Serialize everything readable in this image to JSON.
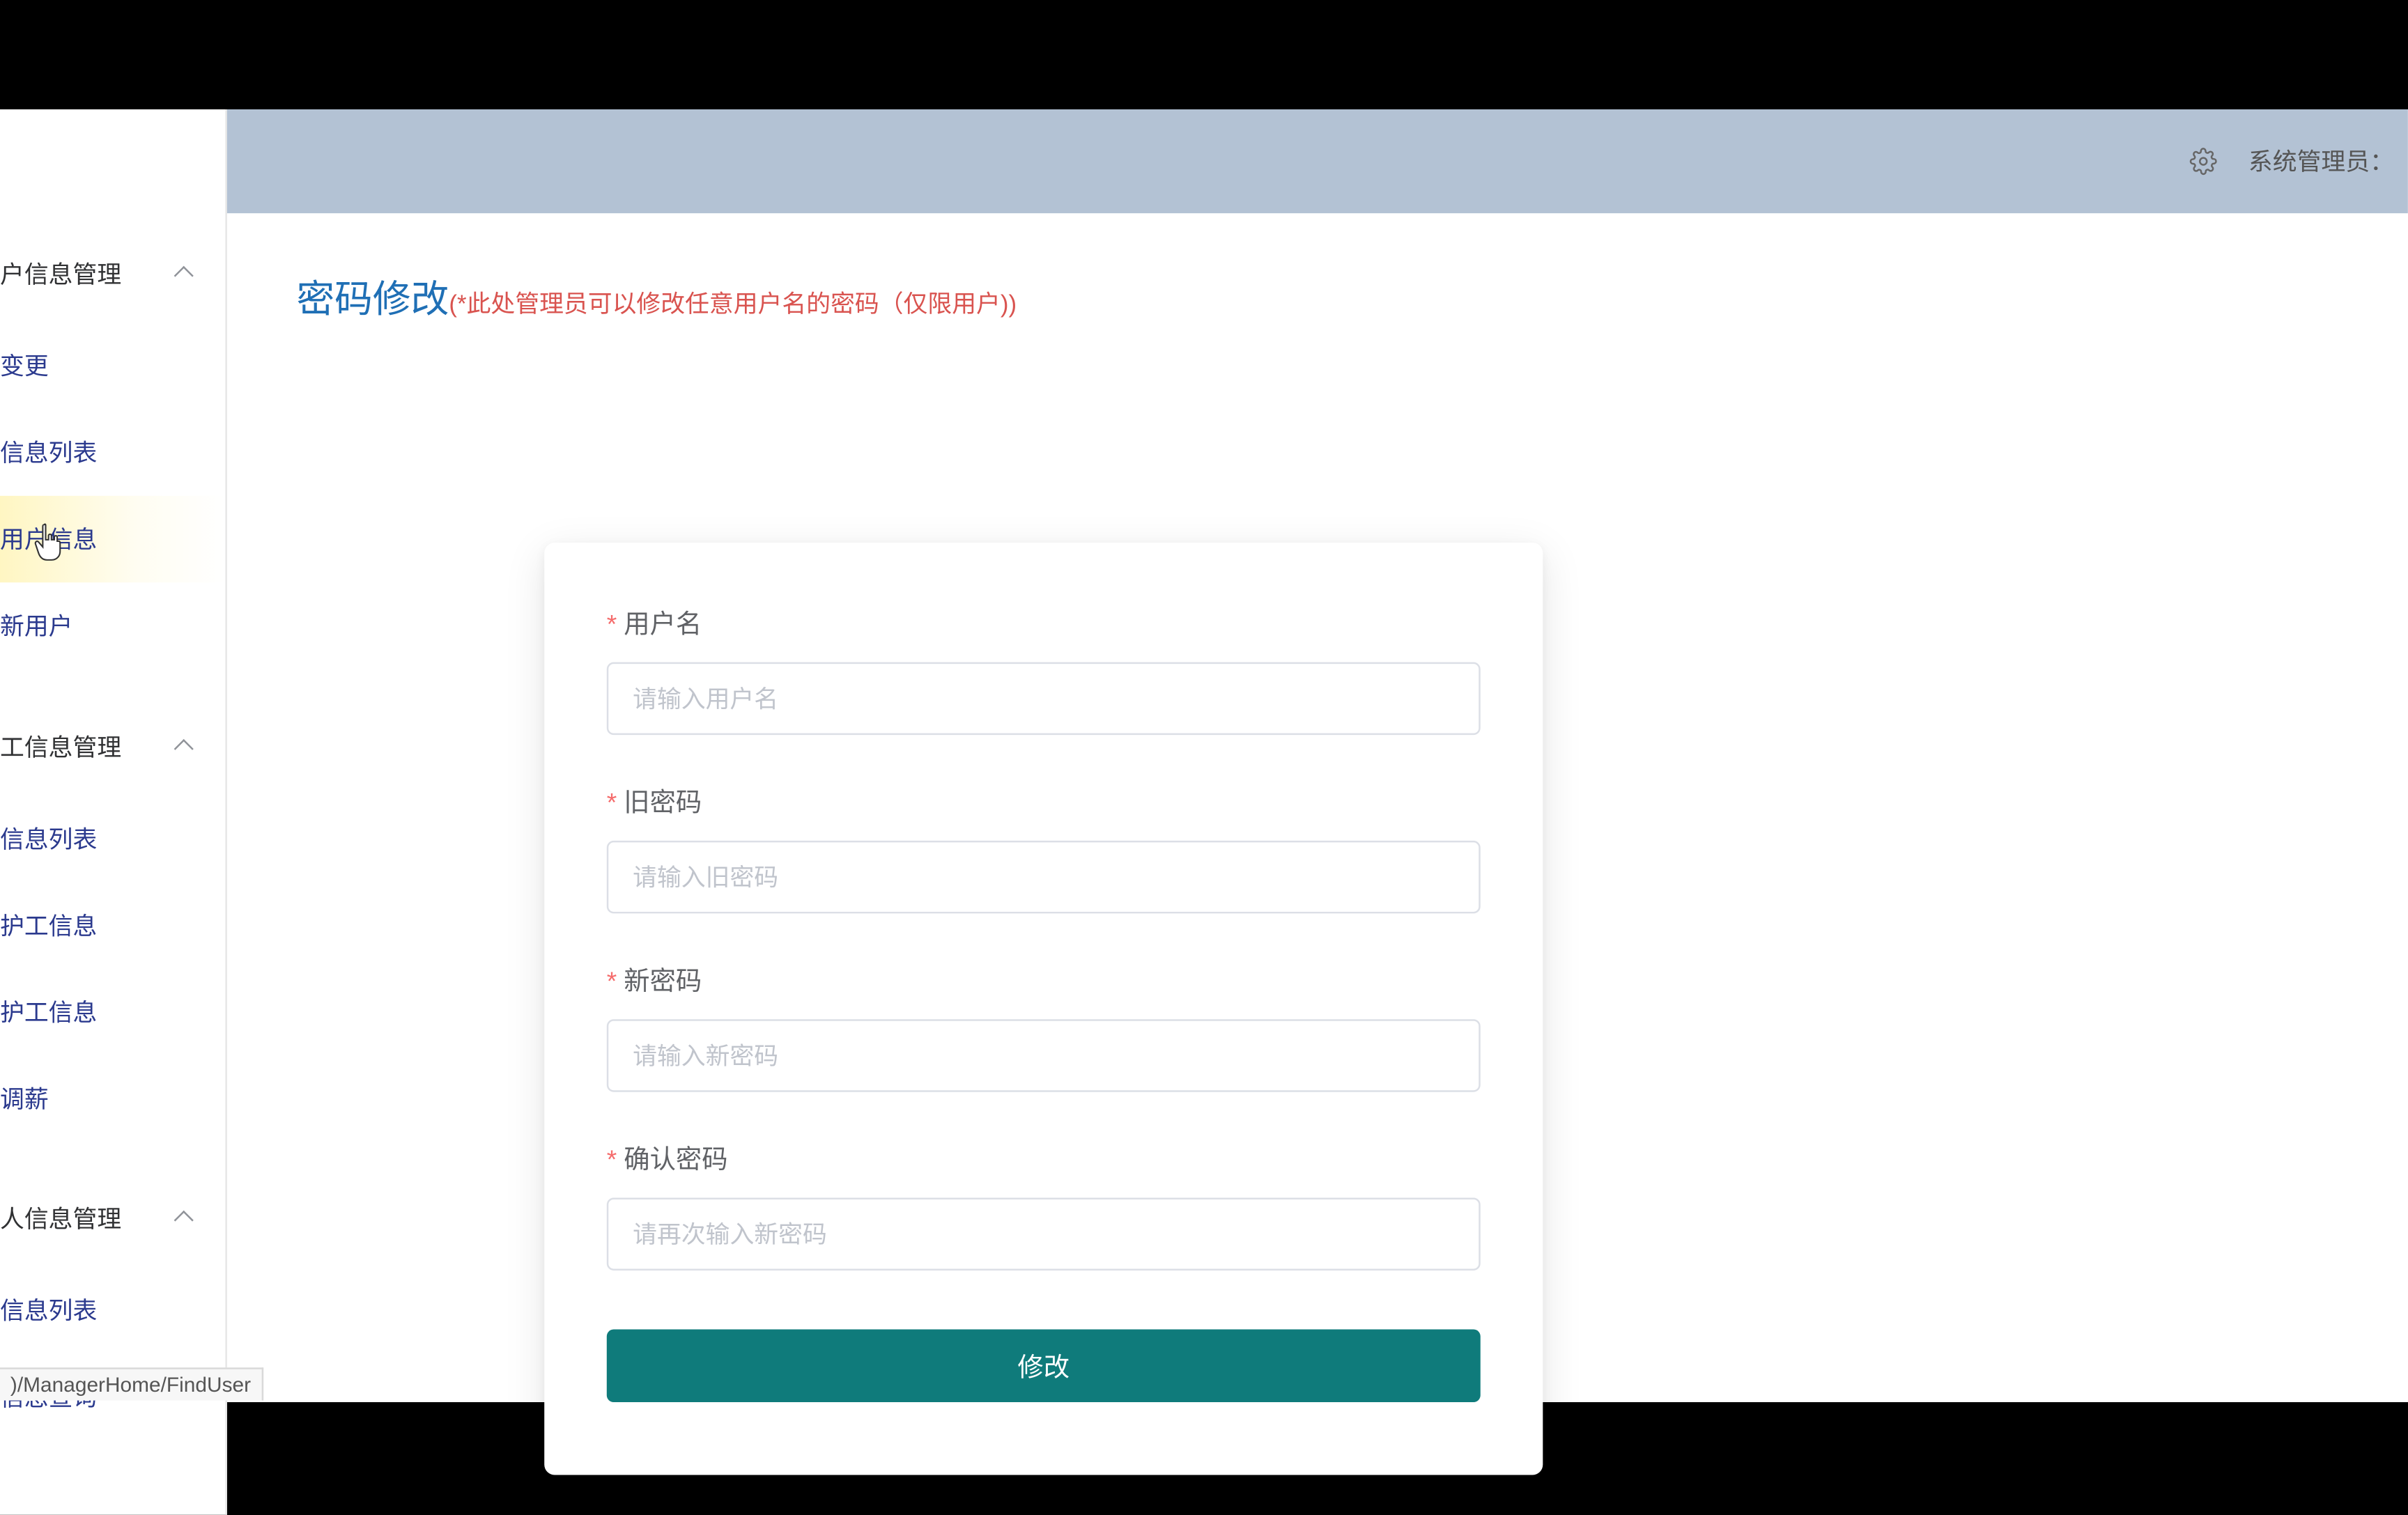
{
  "header": {
    "admin_label": "系统管理员："
  },
  "sidebar": {
    "group1": {
      "label": "户信息管理"
    },
    "group1_items": [
      {
        "label": "变更"
      },
      {
        "label": "信息列表"
      },
      {
        "label": "用户信息"
      },
      {
        "label": "新用户"
      }
    ],
    "group2": {
      "label": "工信息管理"
    },
    "group2_items": [
      {
        "label": "信息列表"
      },
      {
        "label": "护工信息"
      },
      {
        "label": "护工信息"
      },
      {
        "label": "调薪"
      }
    ],
    "group3": {
      "label": "人信息管理"
    },
    "group3_items": [
      {
        "label": "信息列表"
      },
      {
        "label": "信息查询"
      }
    ]
  },
  "page": {
    "title": "密码修改",
    "note": "(*此处管理员可以修改任意用户名的密码（仅限用户))"
  },
  "form": {
    "username": {
      "label": "用户名",
      "placeholder": "请输入用户名"
    },
    "old_password": {
      "label": "旧密码",
      "placeholder": "请输入旧密码"
    },
    "new_password": {
      "label": "新密码",
      "placeholder": "请输入新密码"
    },
    "confirm_password": {
      "label": "确认密码",
      "placeholder": "请再次输入新密码"
    },
    "submit": "修改"
  },
  "status": {
    "url_fragment": ")/ManagerHome/FindUser"
  },
  "colors": {
    "accent": "#0f7b7b",
    "header_bg": "#b3c2d4",
    "link": "#2b3a8e",
    "title": "#1f6fb5",
    "note": "#d9534f"
  }
}
